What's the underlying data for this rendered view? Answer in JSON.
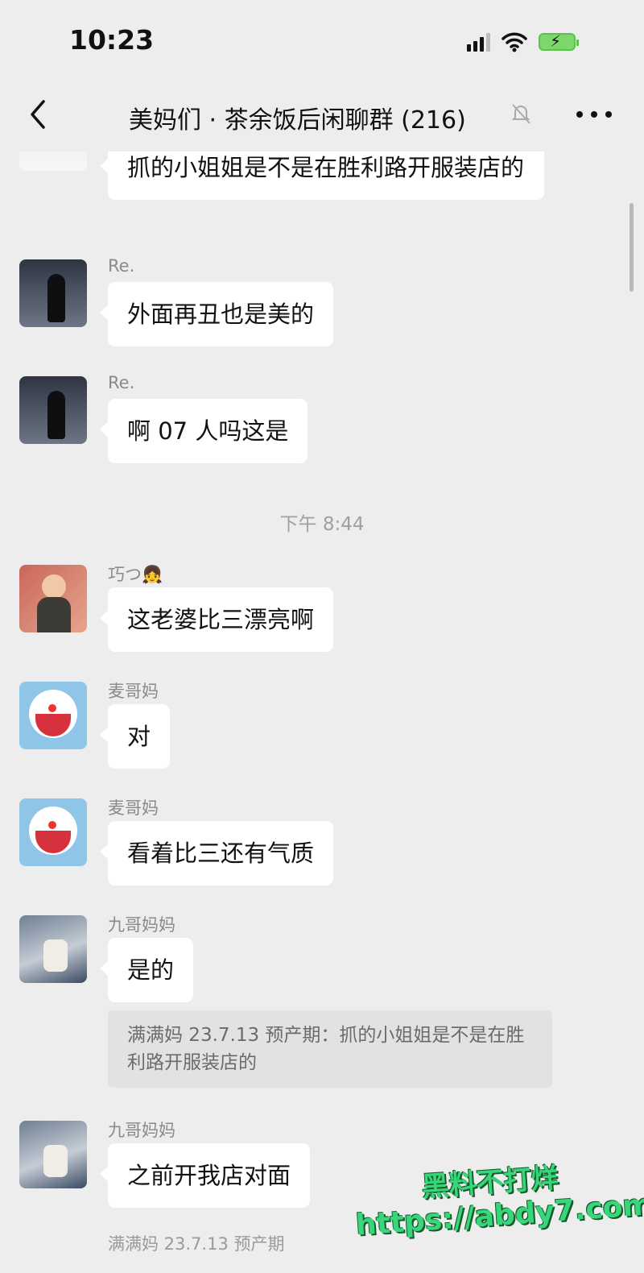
{
  "status": {
    "time": "10:23"
  },
  "nav": {
    "title": "美妈们 · 茶余饭后闲聊群 (216)"
  },
  "messages": [
    {
      "sender": "",
      "text": "抓的小姐姐是不是在胜利路开服装店的"
    },
    {
      "sender": "Re.",
      "text": "外面再丑也是美的"
    },
    {
      "sender": "Re.",
      "text": "啊 07 人吗这是"
    },
    {
      "timestamp": "下午 8:44"
    },
    {
      "sender": "巧つ👧",
      "text": "这老婆比三漂亮啊"
    },
    {
      "sender": "麦哥妈",
      "text": "对"
    },
    {
      "sender": "麦哥妈",
      "text": "看着比三还有气质"
    },
    {
      "sender": "九哥妈妈",
      "text": "是的",
      "quote": "满满妈 23.7.13 预产期：抓的小姐姐是不是在胜利路开服装店的"
    },
    {
      "sender": "九哥妈妈",
      "text": "之前开我店对面"
    }
  ],
  "partial_sender": "满满妈 23.7.13 预产期",
  "watermark": {
    "line1": "黑料不打烊",
    "line2": "https://abdy7.com"
  },
  "colors": {
    "background": "#ededed",
    "bubble": "#ffffff",
    "quote": "#e2e2e2",
    "watermark": "#37d67a"
  }
}
